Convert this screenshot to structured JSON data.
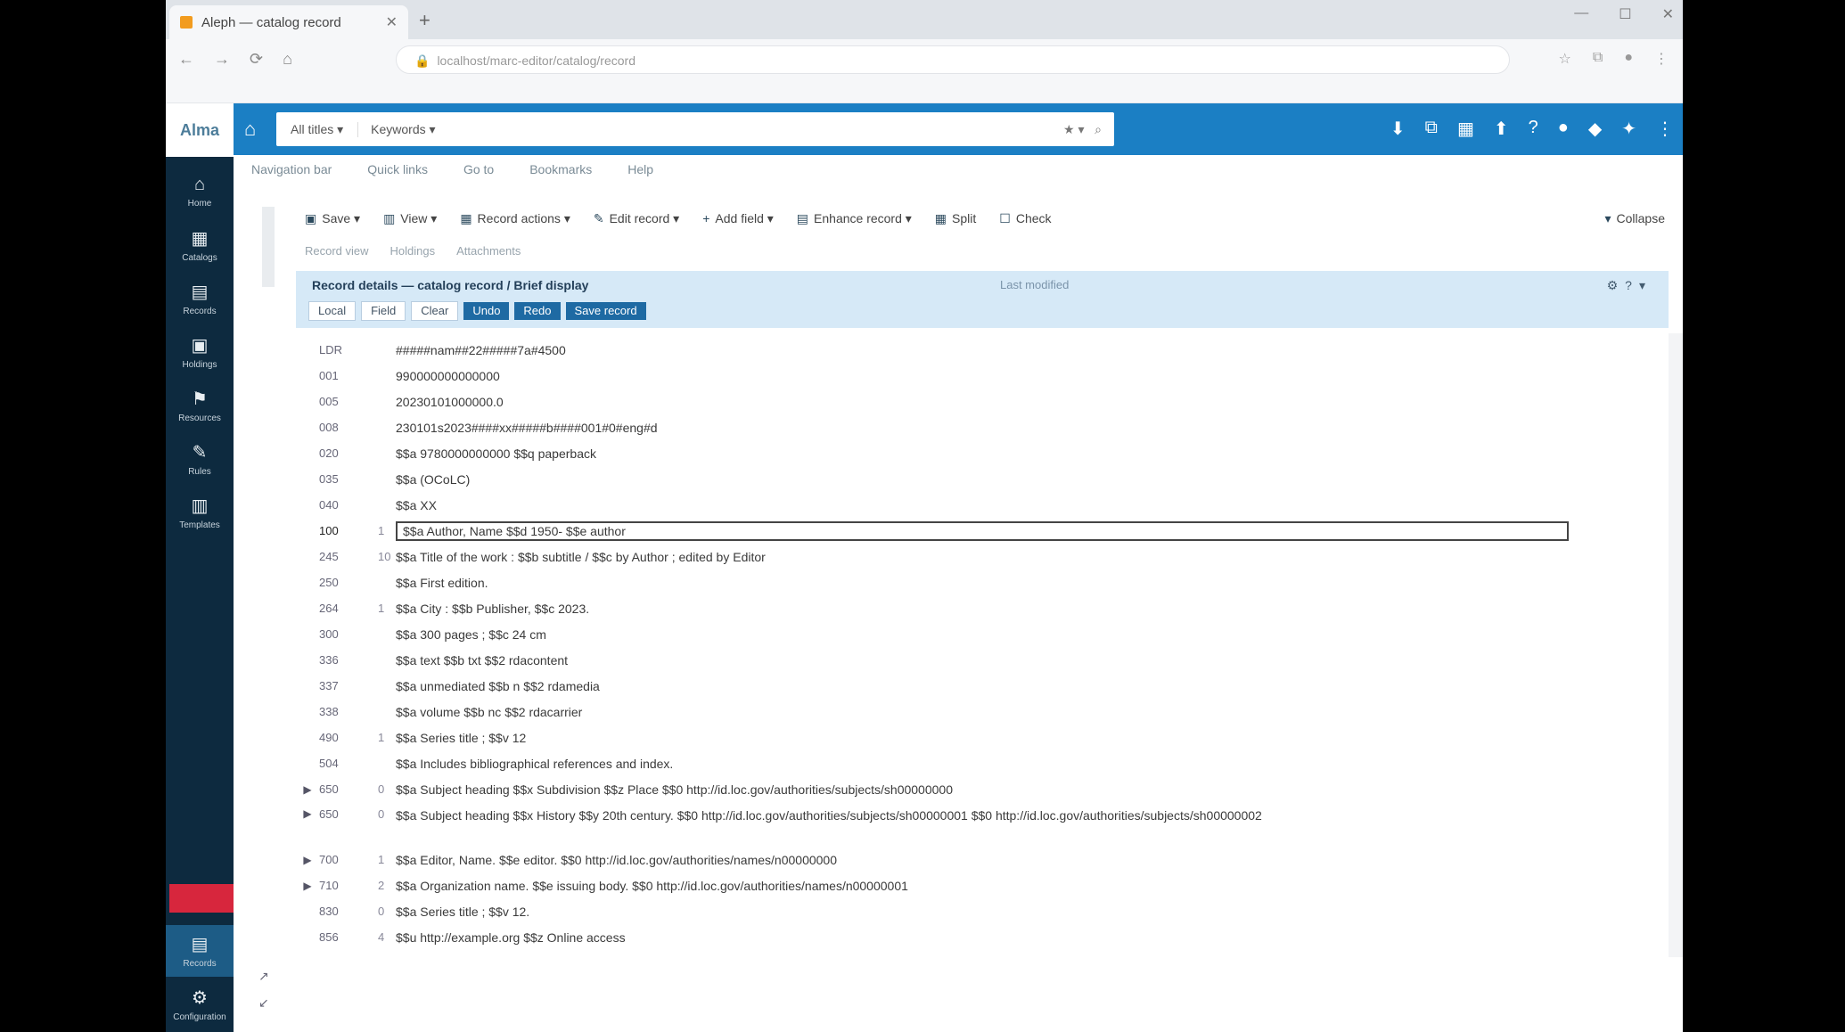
{
  "browser": {
    "tab_title": "Aleph — catalog record",
    "url": "localhost/marc-editor/catalog/record"
  },
  "app": {
    "logo": "Alma",
    "search_scope": "All titles ▾",
    "search_field": "Keywords ▾"
  },
  "sidebar": {
    "items": [
      {
        "icon": "home-icon",
        "label": "Home"
      },
      {
        "icon": "grid-icon",
        "label": "Catalogs"
      },
      {
        "icon": "book-icon",
        "label": "Records"
      },
      {
        "icon": "folder-icon",
        "label": "Holdings"
      },
      {
        "icon": "flag-icon",
        "label": "Resources"
      },
      {
        "icon": "ruler-icon",
        "label": "Rules"
      },
      {
        "icon": "doc-icon",
        "label": "Templates"
      },
      {
        "icon": "record-icon",
        "label": "Records"
      },
      {
        "icon": "gear-icon",
        "label": "Configuration"
      }
    ]
  },
  "subnav": [
    "Navigation bar",
    "Quick links",
    "Go to",
    "Bookmarks",
    "Help"
  ],
  "toolbar": [
    {
      "icon": "save-icon",
      "label": "Save ▾"
    },
    {
      "icon": "view-icon",
      "label": "View ▾"
    },
    {
      "icon": "record-icon",
      "label": "Record actions ▾"
    },
    {
      "icon": "edit-icon",
      "label": "Edit record ▾"
    },
    {
      "icon": "plus-icon",
      "label": "Add field ▾"
    },
    {
      "icon": "tools-icon",
      "label": "Enhance record ▾"
    },
    {
      "icon": "split-icon",
      "label": "Split"
    },
    {
      "icon": "check-icon",
      "label": "Check"
    }
  ],
  "toolbar_right": "Collapse",
  "breadcrumbs": [
    "Record view",
    "Holdings",
    "Attachments"
  ],
  "record": {
    "title": "Record details — catalog record / Brief display",
    "note": "Last modified",
    "chips": [
      "Local",
      "Field",
      "Clear",
      "Undo",
      "Redo",
      "Save record"
    ]
  },
  "fields": [
    {
      "tag": "LDR",
      "ind": "",
      "content": "#####nam##22#####7a#4500",
      "expand": false
    },
    {
      "tag": "001",
      "ind": "",
      "content": "990000000000000",
      "expand": false
    },
    {
      "tag": "005",
      "ind": "",
      "content": "20230101000000.0",
      "expand": false
    },
    {
      "tag": "008",
      "ind": "",
      "content": "230101s2023####xx#####b####001#0#eng#d",
      "expand": false
    },
    {
      "tag": "020",
      "ind": "",
      "content": "$$a 9780000000000 $$q paperback",
      "expand": false
    },
    {
      "tag": "035",
      "ind": "",
      "content": "$$a (OCoLC)",
      "expand": false
    },
    {
      "tag": "040",
      "ind": "",
      "content": "$$a XX",
      "expand": false
    },
    {
      "tag": "100",
      "ind": "1",
      "content": "$$a Author, Name $$d 1950- $$e author",
      "expand": false,
      "selected": true
    },
    {
      "tag": "245",
      "ind": "10",
      "content": "$$a Title of the work : $$b subtitle / $$c by Author ; edited by Editor",
      "expand": false
    },
    {
      "tag": "250",
      "ind": "",
      "content": "$$a First edition.",
      "expand": false
    },
    {
      "tag": "264",
      "ind": "1",
      "content": "$$a City : $$b Publisher, $$c 2023.",
      "expand": false
    },
    {
      "tag": "300",
      "ind": "",
      "content": "$$a 300 pages ; $$c 24 cm",
      "expand": false
    },
    {
      "tag": "336",
      "ind": "",
      "content": "$$a text $$b txt $$2 rdacontent",
      "expand": false
    },
    {
      "tag": "337",
      "ind": "",
      "content": "$$a unmediated $$b n $$2 rdamedia",
      "expand": false
    },
    {
      "tag": "338",
      "ind": "",
      "content": "$$a volume $$b nc $$2 rdacarrier",
      "expand": false
    },
    {
      "tag": "490",
      "ind": "1",
      "content": "$$a Series title ; $$v 12",
      "expand": false
    },
    {
      "tag": "504",
      "ind": "",
      "content": "$$a Includes bibliographical references and index.",
      "expand": false
    },
    {
      "tag": "650",
      "ind": "0",
      "content": "$$a Subject heading $$x Subdivision $$z Place $$0 http://id.loc.gov/authorities/subjects/sh00000000",
      "expand": true
    },
    {
      "tag": "650",
      "ind": "0",
      "content": "$$a Subject heading $$x History $$y 20th century. $$0 http://id.loc.gov/authorities/subjects/sh00000001 $$0 http://id.loc.gov/authorities/subjects/sh00000002",
      "expand": true,
      "tall": true
    },
    {
      "tag": "700",
      "ind": "1",
      "content": "$$a Editor, Name. $$e editor. $$0 http://id.loc.gov/authorities/names/n00000000",
      "expand": true
    },
    {
      "tag": "710",
      "ind": "2",
      "content": "$$a Organization name. $$e issuing body. $$0 http://id.loc.gov/authorities/names/n00000001",
      "expand": true
    },
    {
      "tag": "830",
      "ind": "0",
      "content": "$$a Series title ; $$v 12.",
      "expand": false
    },
    {
      "tag": "856",
      "ind": "4",
      "content": "$$u http://example.org $$z Online access",
      "expand": false
    }
  ]
}
